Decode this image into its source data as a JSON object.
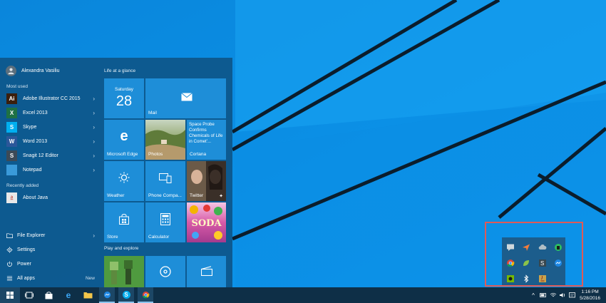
{
  "start_menu": {
    "user_name": "Alexandra Vasiliu",
    "most_used_label": "Most used",
    "recently_added_label": "Recently added",
    "most_used": [
      {
        "label": "Adobe Illustrator CC 2015",
        "icon": "illustrator-icon",
        "badge": "Ai",
        "color": "#3b1f0d"
      },
      {
        "label": "Excel 2013",
        "icon": "excel-icon",
        "badge": "X",
        "color": "#1e7145"
      },
      {
        "label": "Skype",
        "icon": "skype-icon",
        "badge": "S",
        "color": "#00aff0"
      },
      {
        "label": "Word 2013",
        "icon": "word-icon",
        "badge": "W",
        "color": "#2b579a"
      },
      {
        "label": "Snagit 12 Editor",
        "icon": "snagit-icon",
        "badge": "S",
        "color": "#3c4a57"
      },
      {
        "label": "Notepad",
        "icon": "notepad-icon",
        "badge": "",
        "color": "#3a9ad9"
      }
    ],
    "recently_added": [
      {
        "label": "About Java",
        "icon": "java-icon",
        "color": "#e8e8e8"
      }
    ],
    "bottom": {
      "file_explorer": "File Explorer",
      "settings": "Settings",
      "power": "Power",
      "all_apps": "All apps",
      "new_badge": "New"
    }
  },
  "tiles": {
    "life_heading": "Life at a glance",
    "play_heading": "Play and explore",
    "calendar_day": "Saturday",
    "calendar_date": "28",
    "mail": "Mail",
    "edge": "Microsoft Edge",
    "photos": "Photos",
    "cortana_headline": "Space Probe Confirms Chemicals of Life in Comet'...",
    "cortana": "Cortana",
    "weather": "Weather",
    "phone": "Phone Compa...",
    "twitter": "Twitter",
    "store": "Store",
    "calculator": "Calculator",
    "candy_text": "SODA"
  },
  "tray": {
    "icons": [
      "chat-icon",
      "send-icon",
      "cloud-icon",
      "evernote-icon",
      "chrome-icon",
      "leaf-icon",
      "snagit-tray-icon",
      "messenger-icon",
      "nvidia-icon",
      "bluetooth-icon",
      "java-tray-icon"
    ]
  },
  "taskbar": {
    "time": "1:16 PM",
    "date": "5/28/2016"
  },
  "colors": {
    "accent": "#0e568a",
    "tile": "#1e8ed8",
    "highlight": "#e05a57"
  }
}
